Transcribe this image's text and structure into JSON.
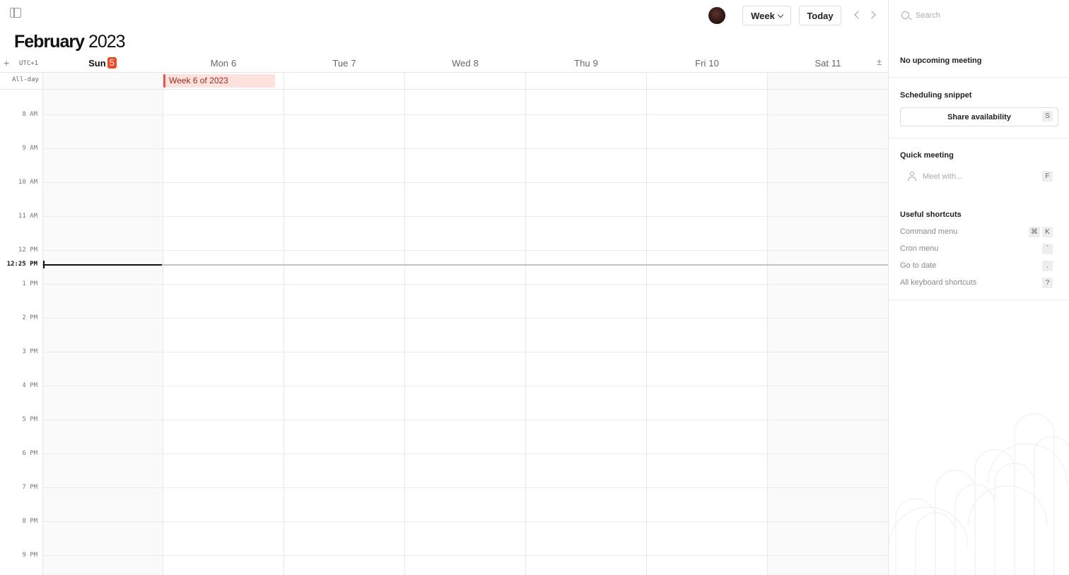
{
  "header": {
    "month": "February",
    "year": "2023",
    "view_label": "Week",
    "today_label": "Today",
    "add_timezone": "+",
    "timezone": "UTC+1",
    "collapse_toggle": "±"
  },
  "days": [
    {
      "name": "Sun",
      "num": "5",
      "today": true
    },
    {
      "name": "Mon",
      "num": "6",
      "today": false
    },
    {
      "name": "Tue",
      "num": "7",
      "today": false
    },
    {
      "name": "Wed",
      "num": "8",
      "today": false
    },
    {
      "name": "Thu",
      "num": "9",
      "today": false
    },
    {
      "name": "Fri",
      "num": "10",
      "today": false
    },
    {
      "name": "Sat",
      "num": "11",
      "today": false
    }
  ],
  "allday_label": "All-day",
  "allday_events": [
    {
      "title": "Week 6 of 2023",
      "day": "Mon"
    }
  ],
  "hours": [
    "8 AM",
    "9 AM",
    "10 AM",
    "11 AM",
    "12 PM",
    "1 PM",
    "2 PM",
    "3 PM",
    "4 PM",
    "5 PM",
    "6 PM",
    "7 PM",
    "8 PM",
    "9 PM"
  ],
  "now_label": "12:25 PM",
  "panel": {
    "search_placeholder": "Search",
    "upcoming_title": "No upcoming meeting",
    "scheduling_title": "Scheduling snippet",
    "share_label": "Share availability",
    "share_key": "S",
    "quick_title": "Quick meeting",
    "meet_placeholder": "Meet with...",
    "meet_key": "F",
    "shortcuts_title": "Useful shortcuts",
    "shortcuts": [
      {
        "label": "Command menu",
        "keys": [
          "⌘",
          "K"
        ]
      },
      {
        "label": "Cron menu",
        "keys": [
          "`"
        ]
      },
      {
        "label": "Go to date",
        "keys": [
          "."
        ]
      },
      {
        "label": "All keyboard shortcuts",
        "keys": [
          "?"
        ]
      }
    ]
  },
  "colors": {
    "today_badge": "#f04a23",
    "event_bg": "#fde1dd",
    "event_border": "#e25b4f",
    "event_text": "#9a2a1e"
  },
  "icons": [
    "sidebar-toggle-icon",
    "chevron-down-icon",
    "chevron-left-icon",
    "chevron-right-icon",
    "search-icon",
    "person-icon"
  ]
}
